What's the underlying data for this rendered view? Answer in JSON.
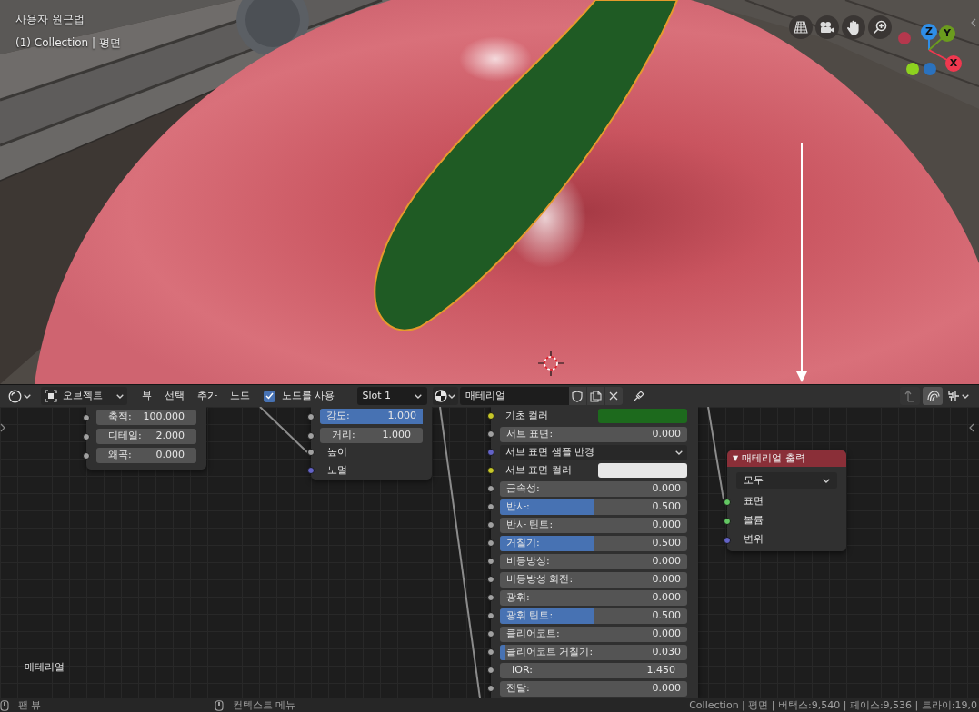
{
  "viewport": {
    "view_name": "사용자 원근법",
    "collection_line": "(1) Collection | 평면",
    "gizmo_axes": [
      {
        "label": "Z",
        "color": "#2f8ee8"
      },
      {
        "label": "Y",
        "color": "#6b9b1e"
      },
      {
        "label": "X",
        "color": "#f0384f"
      }
    ]
  },
  "node_header": {
    "mode": "오브젝트",
    "menus": [
      "뷰",
      "선택",
      "추가",
      "노드"
    ],
    "use_nodes": {
      "label": "노드를 사용",
      "checked": true
    },
    "slot": "Slot 1",
    "material": "매테리얼"
  },
  "noise_node": {
    "fields": [
      {
        "kind": "number",
        "label": "축적:",
        "value": "100.000"
      },
      {
        "kind": "number",
        "label": "디테일:",
        "value": "2.000"
      },
      {
        "kind": "number",
        "label": "왜곡:",
        "value": "0.000"
      }
    ]
  },
  "bump_node": {
    "fields": [
      {
        "kind": "factor",
        "label": "강도:",
        "value": "1.000",
        "level": 1
      },
      {
        "kind": "number",
        "label": "거리:",
        "value": "1.000"
      }
    ],
    "inputs": [
      {
        "label": "높이",
        "color": "#a1a1a1"
      },
      {
        "label": "노멀",
        "color": "#6363c7"
      }
    ]
  },
  "bsdf_node": {
    "rows": [
      {
        "kind": "color",
        "label": "기초 컬러",
        "socket": {
          "color": "#c7c729"
        },
        "swatch": {
          "color": "#1d6a1d"
        }
      },
      {
        "kind": "factor",
        "label": "서브 표면:",
        "value": "0.000",
        "level": 0,
        "socket": {
          "color": "#a1a1a1"
        }
      },
      {
        "kind": "menu",
        "label": "서브 표면 샘플 반경",
        "socket": {
          "color": "#6363c7"
        }
      },
      {
        "kind": "color",
        "label": "서브 표면 컬러",
        "socket": {
          "color": "#c7c729"
        },
        "swatch": {
          "color": "#e8e8e8"
        }
      },
      {
        "kind": "factor",
        "label": "금속성:",
        "value": "0.000",
        "level": 0,
        "socket": {
          "color": "#a1a1a1"
        }
      },
      {
        "kind": "factor",
        "label": "반사:",
        "value": "0.500",
        "level": 0.5,
        "socket": {
          "color": "#a1a1a1"
        }
      },
      {
        "kind": "factor",
        "label": "반사 틴트:",
        "value": "0.000",
        "level": 0,
        "socket": {
          "color": "#a1a1a1"
        }
      },
      {
        "kind": "factor",
        "label": "거칠기:",
        "value": "0.500",
        "level": 0.5,
        "socket": {
          "color": "#a1a1a1"
        }
      },
      {
        "kind": "factor",
        "label": "비등방성:",
        "value": "0.000",
        "level": 0,
        "socket": {
          "color": "#a1a1a1"
        }
      },
      {
        "kind": "factor",
        "label": "비등방성 회전:",
        "value": "0.000",
        "level": 0,
        "socket": {
          "color": "#a1a1a1"
        }
      },
      {
        "kind": "factor",
        "label": "광휘:",
        "value": "0.000",
        "level": 0,
        "socket": {
          "color": "#a1a1a1"
        }
      },
      {
        "kind": "factor",
        "label": "광휘 틴트:",
        "value": "0.500",
        "level": 0.5,
        "socket": {
          "color": "#a1a1a1"
        }
      },
      {
        "kind": "factor",
        "label": "클리어코트:",
        "value": "0.000",
        "level": 0,
        "socket": {
          "color": "#a1a1a1"
        }
      },
      {
        "kind": "factor",
        "label": "클리어코트 거칠기:",
        "value": "0.030",
        "level": 0.03,
        "socket": {
          "color": "#a1a1a1"
        }
      },
      {
        "kind": "number",
        "label": "IOR:",
        "value": "1.450",
        "socket": {
          "color": "#a1a1a1"
        }
      },
      {
        "kind": "factor",
        "label": "전달:",
        "value": "0.000",
        "level": 0,
        "socket": {
          "color": "#a1a1a1"
        }
      }
    ]
  },
  "output_node": {
    "collapse": "▼",
    "title": "매테리얼 출력",
    "target": "모두",
    "inputs": [
      {
        "label": "표면",
        "color": "#63c763"
      },
      {
        "label": "볼륨",
        "color": "#63c763"
      },
      {
        "label": "변위",
        "color": "#6363c7"
      }
    ]
  },
  "tree_name": "매테리얼",
  "status_bar": {
    "hints": [
      "팬 뷰",
      "컨텍스트 메뉴"
    ],
    "stats": "Collection | 평면 | 버택스:9,540 | 페이스:9,536 | 트라이:19,0"
  }
}
